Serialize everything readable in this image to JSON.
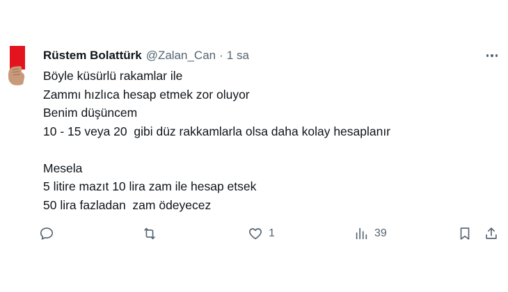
{
  "author": {
    "name": "Rüstem Bolattürk",
    "handle": "@Zalan_Can",
    "separator": "·",
    "time": "1 sa",
    "avatar_color": "#e4141e"
  },
  "post": {
    "lines": [
      "Böyle küsürlü rakamlar ile",
      "Zammı hızlıca hesap etmek zor oluyor",
      "Benim düşüncem",
      "10 - 15 veya 20  gibi düz rakkamlarla olsa daha kolay hesaplanır",
      "",
      "Mesela",
      "5 litire mazıt 10 lira zam ile hesap etsek",
      "50 lira fazladan  zam ödeyecez"
    ]
  },
  "actions": {
    "reply": {
      "icon": "reply-icon",
      "count": ""
    },
    "repost": {
      "icon": "repost-icon",
      "count": ""
    },
    "like": {
      "icon": "heart-icon",
      "count": "1"
    },
    "views": {
      "icon": "views-icon",
      "count": "39"
    },
    "bookmark": {
      "icon": "bookmark-icon"
    },
    "share": {
      "icon": "share-icon"
    }
  },
  "colors": {
    "text_primary": "#0f1419",
    "text_secondary": "#536471"
  }
}
